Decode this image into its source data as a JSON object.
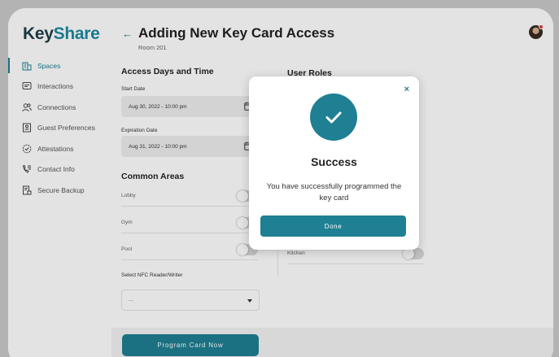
{
  "app": {
    "logo_part1": "Key",
    "logo_part2": "Share",
    "brand_color": "#1f7f93"
  },
  "sidebar": {
    "items": [
      {
        "label": "Spaces",
        "icon": "building-icon",
        "active": true
      },
      {
        "label": "Interactions",
        "icon": "chat-icon",
        "active": false
      },
      {
        "label": "Connections",
        "icon": "people-icon",
        "active": false
      },
      {
        "label": "Guest Preferences",
        "icon": "id-card-icon",
        "active": false
      },
      {
        "label": "Attestations",
        "icon": "badge-check-icon",
        "active": false
      },
      {
        "label": "Contact Info",
        "icon": "phone-list-icon",
        "active": false
      },
      {
        "label": "Secure Backup",
        "icon": "backup-icon",
        "active": false
      }
    ]
  },
  "header": {
    "back_icon": "←",
    "title": "Adding New Key Card Access",
    "subtitle": "Room 201"
  },
  "access": {
    "section_title": "Access Days and Time",
    "start_label": "Start Date",
    "start_value": "Aug 30, 2022 - 10:00 pm",
    "expiry_label": "Expiration Date",
    "expiry_value": "Aug 31, 2022 - 10:00 pm"
  },
  "common_areas": {
    "section_title": "Common Areas",
    "items": [
      {
        "label": "Lobby",
        "on": false
      },
      {
        "label": "Gym",
        "on": false
      },
      {
        "label": "Pool",
        "on": false
      }
    ]
  },
  "nfc": {
    "label": "Select NFC Reader/Writer",
    "value": "..."
  },
  "user_roles": {
    "section_title": "User Roles",
    "visible_item": "Kitchen"
  },
  "footer": {
    "program_button": "Program Card Now"
  },
  "modal": {
    "close_icon": "×",
    "title": "Success",
    "message": "You have successfully programmed the key card",
    "done_button": "Done"
  }
}
